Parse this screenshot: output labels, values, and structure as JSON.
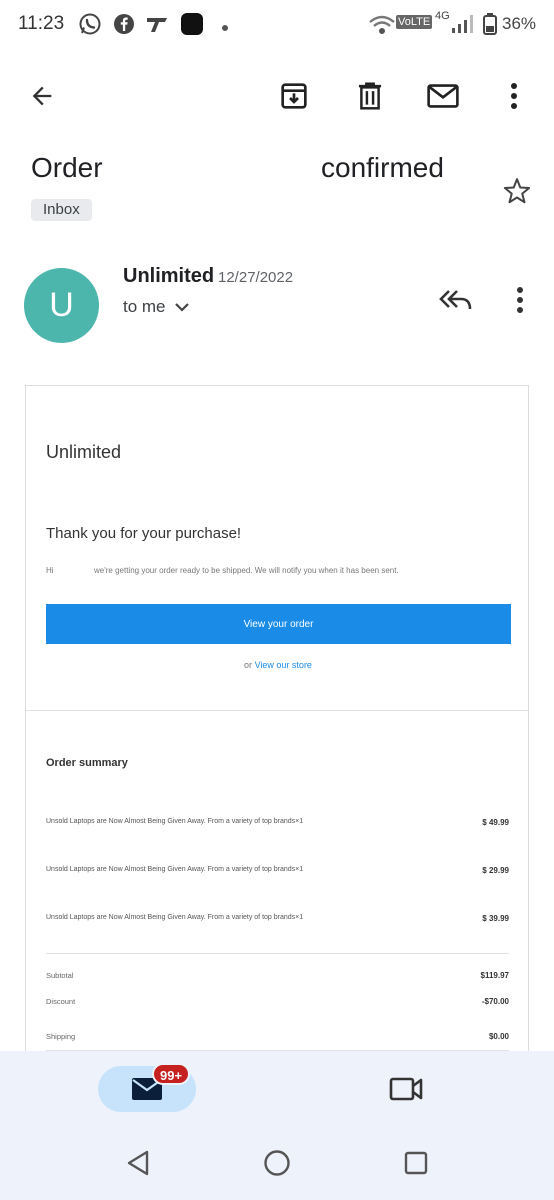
{
  "status_bar": {
    "time": "11:23",
    "network_label": "4G",
    "volte_label": "VoLTE",
    "battery": "36%"
  },
  "toolbar": {
    "icons": [
      "back-arrow-icon",
      "archive-icon",
      "delete-icon",
      "mark-unread-icon",
      "more-vert-icon"
    ]
  },
  "subject": {
    "word1": "Order",
    "word2": "confirmed",
    "label": "Inbox"
  },
  "sender": {
    "initial": "U",
    "name": "Unlimited",
    "date": "12/27/2022",
    "recipient": "to me",
    "avatar_color": "#4db6ac"
  },
  "email": {
    "store_name": "Unlimited",
    "thanks": "Thank you for your purchase!",
    "hi": "Hi",
    "message": "we're getting your order ready to be shipped. We will notify you when it has been sent.",
    "button_label": "View your order",
    "or_text": "or",
    "store_link": "View our store",
    "accent_color": "#1a8ce8",
    "summary_title": "Order summary",
    "items": [
      {
        "name": "Unsold Laptops are Now Almost Being Given Away. From a variety of top brands×1",
        "price": "$ 49.99"
      },
      {
        "name": "Unsold Laptops are Now Almost Being Given Away. From a variety of top brands×1",
        "price": "$ 29.99"
      },
      {
        "name": "Unsold Laptops are Now Almost Being Given Away. From a variety of top brands×1",
        "price": "$ 39.99"
      }
    ],
    "totals": [
      {
        "label": "Subtotal",
        "value": "$119.97"
      },
      {
        "label": "Discount",
        "value": "-$70.00"
      },
      {
        "label": "Shipping",
        "value": "$0.00"
      }
    ]
  },
  "bottom_nav": {
    "badge": "99+",
    "badge_color": "#c5221f"
  }
}
